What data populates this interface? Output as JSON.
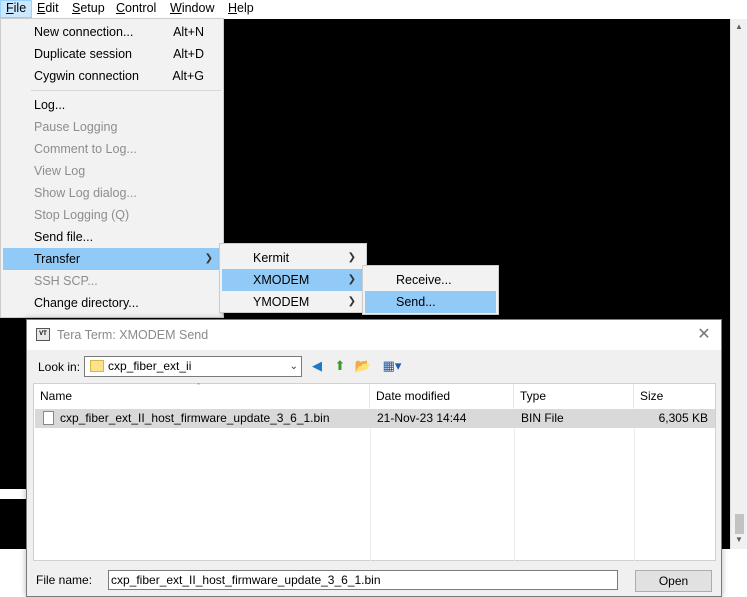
{
  "menubar": {
    "items": [
      {
        "label": "File",
        "accel": "F",
        "rest": "ile"
      },
      {
        "label": "Edit",
        "accel": "E",
        "rest": "dit"
      },
      {
        "label": "Setup",
        "accel": "S",
        "rest": "etup"
      },
      {
        "label": "Control",
        "accel": "C",
        "rest": "ontrol"
      },
      {
        "label": "Window",
        "accel": "W",
        "rest": "indow"
      },
      {
        "label": "Help",
        "accel": "H",
        "rest": "elp"
      }
    ]
  },
  "file_menu": {
    "items": [
      {
        "label": "New connection...",
        "shortcut": "Alt+N"
      },
      {
        "label": "Duplicate session",
        "shortcut": "Alt+D"
      },
      {
        "label": "Cygwin connection",
        "shortcut": "Alt+G"
      },
      {
        "label": "Log..."
      },
      {
        "label": "Pause Logging"
      },
      {
        "label": "Comment to Log..."
      },
      {
        "label": "View Log"
      },
      {
        "label": "Show Log dialog..."
      },
      {
        "label": "Stop Logging (Q)"
      },
      {
        "label": "Send file..."
      },
      {
        "label": "Transfer"
      },
      {
        "label": "SSH SCP..."
      },
      {
        "label": "Change directory..."
      }
    ]
  },
  "transfer_menu": {
    "items": [
      {
        "label": "Kermit"
      },
      {
        "label": "XMODEM"
      },
      {
        "label": "YMODEM"
      }
    ]
  },
  "xmodem_menu": {
    "items": [
      {
        "label": "Receive..."
      },
      {
        "label": "Send..."
      }
    ]
  },
  "dialog": {
    "title": "Tera Term: XMODEM Send",
    "app_icon": "VT",
    "look_in_label": "Look in:",
    "look_in_value": "cxp_fiber_ext_ii",
    "columns": [
      "Name",
      "Date modified",
      "Type",
      "Size"
    ],
    "files": [
      {
        "name": "cxp_fiber_ext_II_host_firmware_update_3_6_1.bin",
        "date": "21-Nov-23 14:44",
        "type": "BIN File",
        "size": "6,305 KB"
      }
    ],
    "file_name_label": "File name:",
    "file_name_value": "cxp_fiber_ext_II_host_firmware_update_3_6_1.bin",
    "open_label": "Open"
  },
  "colors": {
    "terminal_bg": "#000000",
    "menu_highlight": "#91c9f7",
    "menubar_active": "#cce8ff"
  }
}
